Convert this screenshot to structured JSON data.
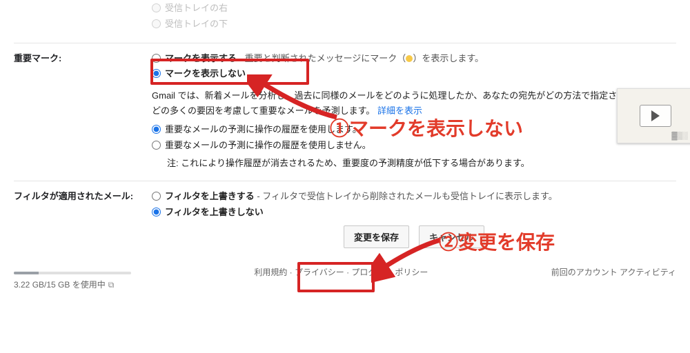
{
  "inbox_layout": {
    "opt1": "受信トレイの右",
    "opt2": "受信トレイの下"
  },
  "important": {
    "label": "重要マーク:",
    "show": "マークを表示する",
    "show_suffix": " - 重要と判断されたメッセージにマーク（",
    "show_suffix2": "）を表示します。",
    "hide": "マークを表示しない",
    "desc": "Gmail では、新着メールを分析し、過去に同様のメールをどのように処理したか、あなたの宛先がどの方法で指定されているかなどの多くの要因を考慮して重要なメールを予測します。",
    "details": "詳細を表示",
    "use_history": "重要なメールの予測に操作の履歴を使用します。",
    "no_history": "重要なメールの予測に操作の履歴を使用しません。",
    "note": "注: これにより操作履歴が消去されるため、重要度の予測精度が低下する場合があります。"
  },
  "filter": {
    "label": "フィルタが適用されたメール:",
    "override": "フィルタを上書きする",
    "override_suffix": " - フィルタで受信トレイから削除されたメールも受信トレイに表示します。",
    "no_override": "フィルタを上書きしない"
  },
  "buttons": {
    "save": "変更を保存",
    "cancel": "キャンセル"
  },
  "foot": {
    "links": "利用規約 · プライバシー · プログラム ポリシー",
    "activity": "前回のアカウント アクティビティ",
    "storage": "3.22 GB/15 GB を使用中"
  },
  "annot": {
    "a1": "①マークを表示しない",
    "a2": "②変更を保存"
  }
}
